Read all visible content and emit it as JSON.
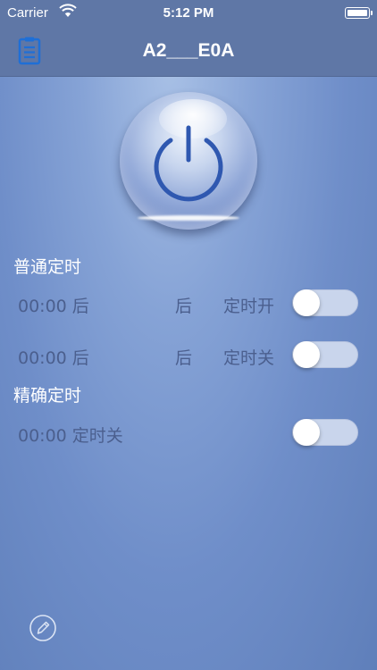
{
  "status_bar": {
    "carrier": "Carrier",
    "time": "5:12 PM",
    "icons": [
      "wifi-icon",
      "battery-icon"
    ]
  },
  "nav": {
    "title": "A2___E0A",
    "menu_icon": "document-list-icon"
  },
  "power": {
    "icon": "power-icon"
  },
  "normal_timer": {
    "title": "普通定时",
    "rows": [
      {
        "time": "00:00 后",
        "mid": "后",
        "label": "定时开",
        "toggle_on": false
      },
      {
        "time": "00:00 后",
        "mid": "后",
        "label": "定时关",
        "toggle_on": false
      }
    ]
  },
  "precise_timer": {
    "title": "精确定时",
    "rows": [
      {
        "time": "00:00 定时关",
        "toggle_on": false
      }
    ]
  },
  "footer": {
    "edit_icon": "pencil-icon"
  },
  "colors": {
    "nav_bg": "#5f77a6",
    "background": "#7793cc",
    "muted_text": "#4b5f8e",
    "toggle_off": "#c9d5ec",
    "icon_blue": "#1f6fd6"
  }
}
